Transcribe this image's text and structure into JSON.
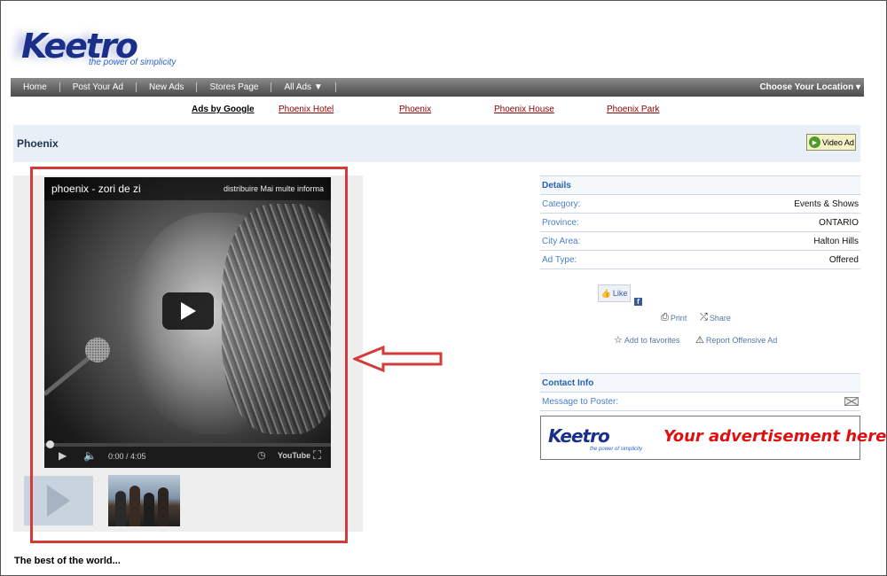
{
  "logo": {
    "word": "Keetro",
    "tagline": "the power of simplicity"
  },
  "nav": {
    "items": [
      "Home",
      "Post Your Ad",
      "New Ads",
      "Stores Page",
      "All Ads ▼"
    ],
    "location": "Choose Your Location ▾"
  },
  "ads": {
    "label": "Ads by Google",
    "links": [
      "Phoenix Hotel",
      "Phoenix",
      "Phoenix House",
      "Phoenix Park"
    ]
  },
  "page": {
    "title": "Phoenix",
    "video_ad_label": "Video Ad"
  },
  "video": {
    "title": "phoenix - zori de zi",
    "top_right": "distribuire  Mai multe informa",
    "time": "0:00 / 4:05",
    "brand": "YouTube"
  },
  "details": {
    "heading": "Details",
    "rows": [
      {
        "label": "Category:",
        "value": "Events & Shows"
      },
      {
        "label": "Province:",
        "value": "ONTARIO"
      },
      {
        "label": "City Area:",
        "value": "Halton Hills"
      },
      {
        "label": "Ad Type:",
        "value": "Offered"
      }
    ]
  },
  "social": {
    "like": "Like",
    "fb": "f",
    "print": "Print",
    "share": "Share",
    "favorite": "Add to favorites",
    "report": "Report Offensive Ad"
  },
  "contact": {
    "heading": "Contact Info",
    "message": "Message to Poster:"
  },
  "banner": {
    "logo": "Keetro",
    "tagline": "the power of simplicity",
    "text": "Your advertisement here!"
  },
  "description": "The best of the world..."
}
